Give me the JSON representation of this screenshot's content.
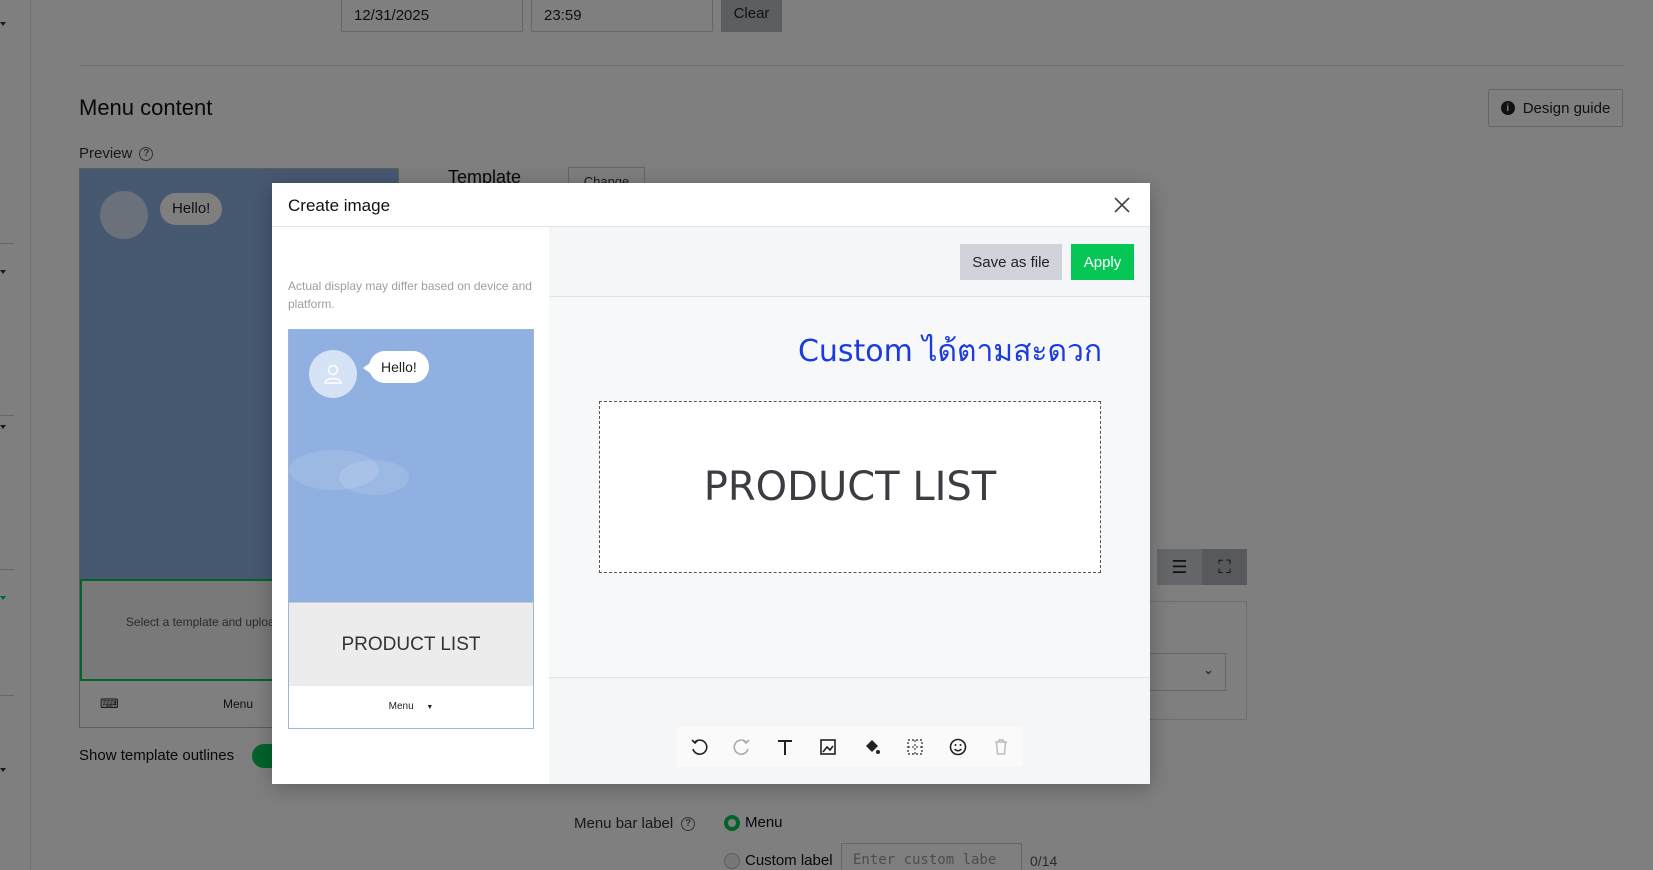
{
  "background": {
    "date_value": "12/31/2025",
    "time_value": "23:59",
    "clear_label": "Clear",
    "section_title": "Menu content",
    "design_guide_label": "Design guide",
    "preview_label": "Preview",
    "template_label": "Template",
    "change_label": "Change",
    "phone_bubble": "Hello!",
    "phone_hint": "Select a template and upload an ap image.",
    "phone_menu": "Menu",
    "show_outlines_label": "Show template outlines",
    "menubar_label": "Menu bar label",
    "radio_menu_label": "Menu",
    "radio_custom_label": "Custom label",
    "custom_placeholder": "Enter custom labe",
    "char_count": "0/14"
  },
  "modal": {
    "title": "Create image",
    "note": "Actual display may differ based on device and platform.",
    "preview": {
      "bubble": "Hello!",
      "menu_text": "PRODUCT LIST",
      "bar_label": "Menu"
    },
    "actions": {
      "save_label": "Save as file",
      "apply_label": "Apply"
    },
    "canvas": {
      "title": "Custom ได้ตามสะดวก",
      "title_color": "#1a3be0",
      "box_text": "PRODUCT LIST"
    },
    "tools": [
      "undo-icon",
      "redo-icon",
      "text-icon",
      "image-icon",
      "fill-icon",
      "grid-icon",
      "emoji-icon",
      "trash-icon"
    ]
  },
  "colors": {
    "accent": "#06c755",
    "overlay": "rgba(0,0,0,0.5)"
  }
}
